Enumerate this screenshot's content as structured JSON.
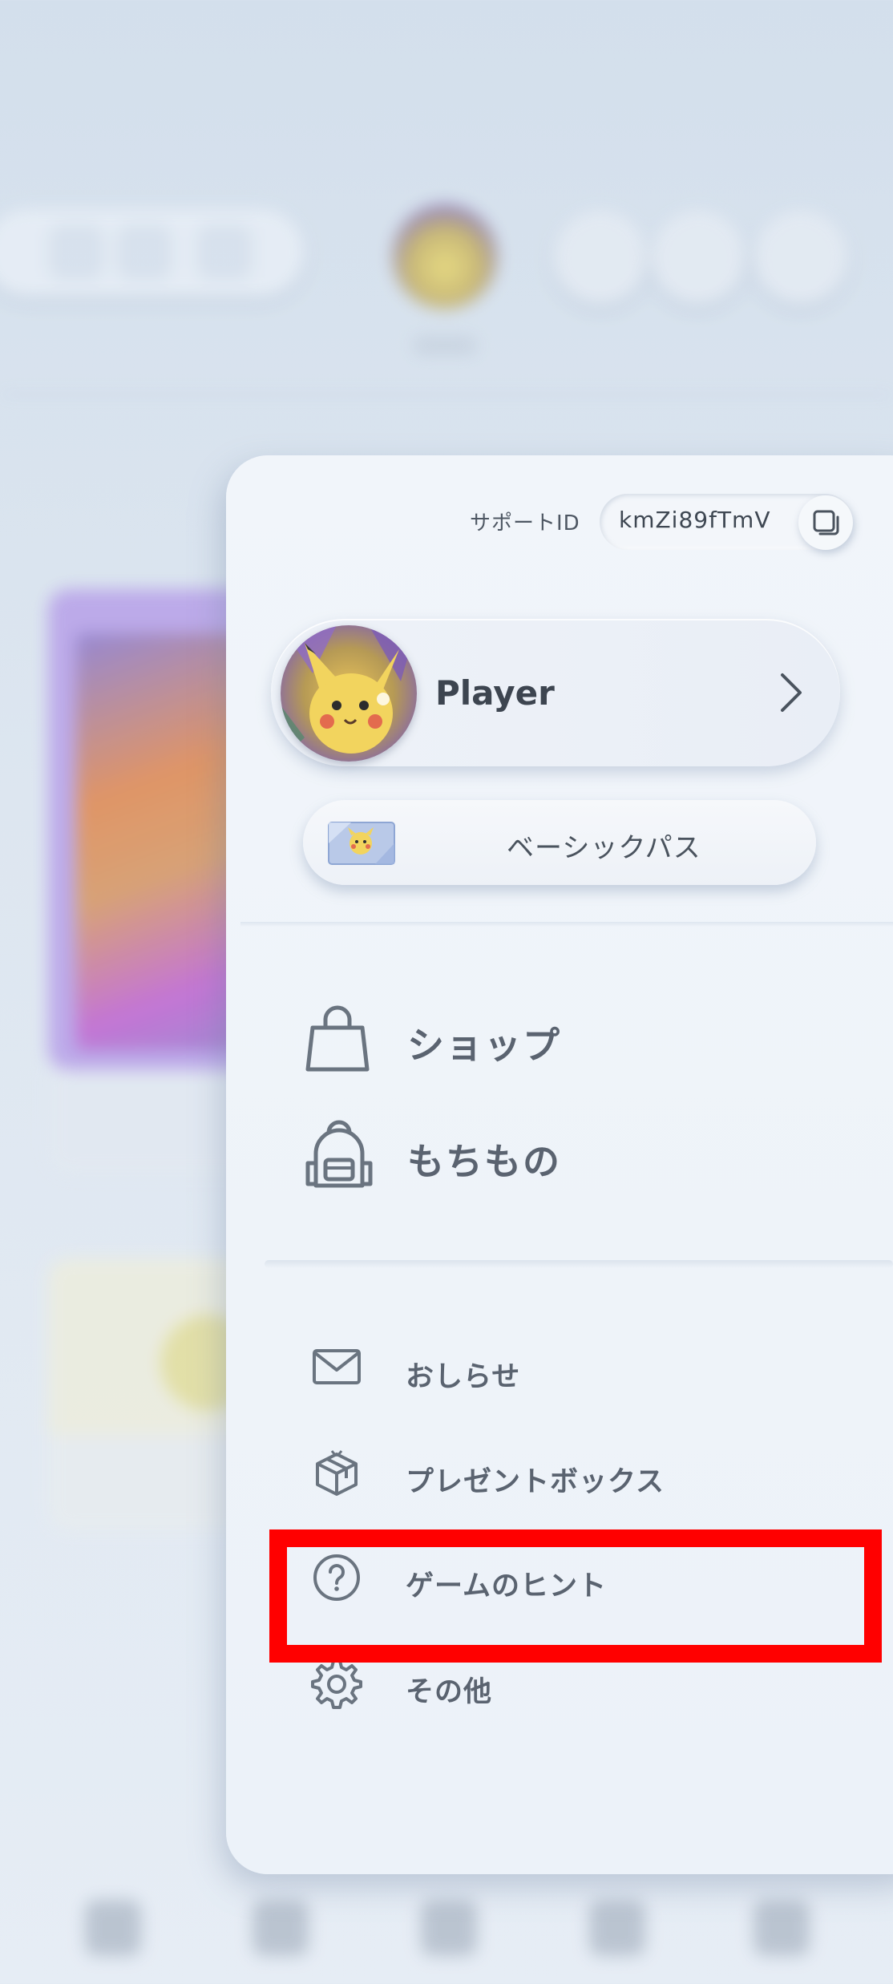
{
  "support": {
    "label": "サポートID",
    "value": "kmZi89fTmV"
  },
  "player": {
    "name": "Player"
  },
  "pass": {
    "label": "ベーシックパス"
  },
  "main_menu": [
    {
      "label": "ショップ",
      "icon": "shopping-bag-icon"
    },
    {
      "label": "もちもの",
      "icon": "backpack-icon"
    }
  ],
  "sub_menu": [
    {
      "label": "おしらせ",
      "icon": "mail-icon"
    },
    {
      "label": "プレゼントボックス",
      "icon": "gift-icon"
    },
    {
      "label": "ゲームのヒント",
      "icon": "help-icon"
    },
    {
      "label": "その他",
      "icon": "gear-icon"
    }
  ],
  "colors": {
    "highlight": "#ff0000",
    "icon_stroke": "#6a7480",
    "text": "#5a6370"
  }
}
